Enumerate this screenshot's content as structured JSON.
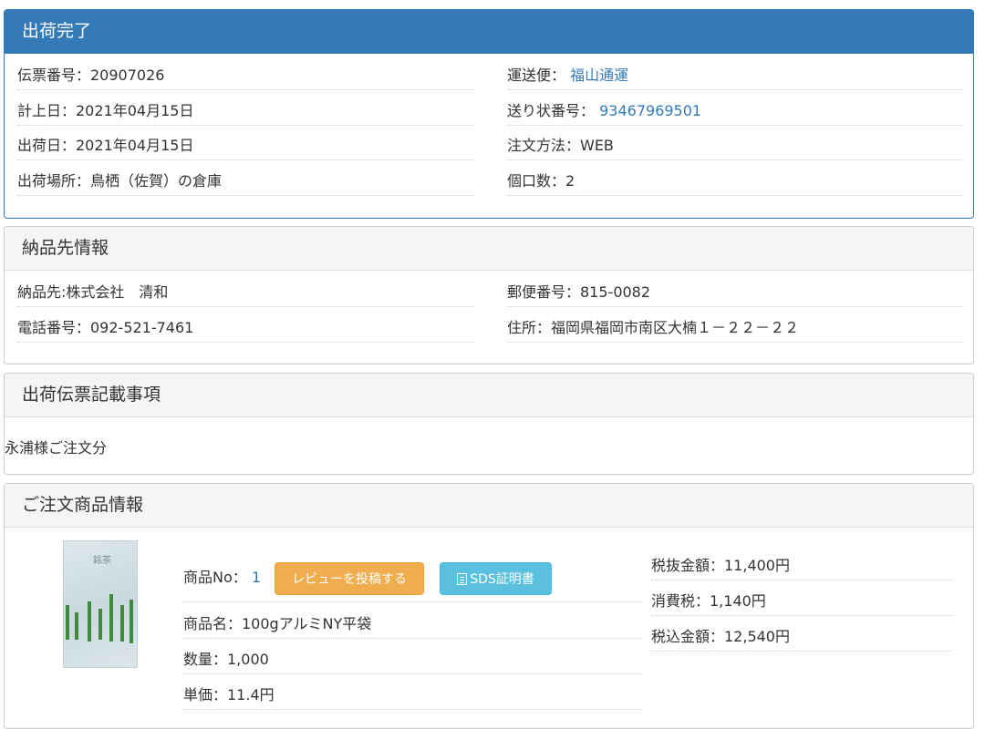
{
  "shipping": {
    "title": "出荷完了",
    "slip_no": "伝票番号：20907026",
    "carrier_label": "運送便：",
    "carrier_value": "福山通運",
    "posting_date": "計上日：2021年04月15日",
    "tracking_label": "送り状番号：",
    "tracking_value": "93467969501",
    "ship_date": "出荷日：2021年04月15日",
    "order_method": "注文方法：WEB",
    "ship_location": "出荷場所：鳥栖（佐賀）の倉庫",
    "packages": "個口数：2"
  },
  "delivery": {
    "title": "納品先情報",
    "recipient": "納品先:株式会社　清和",
    "postal": "郵便番号：815-0082",
    "phone": "電話番号：092-521-7461",
    "address": "住所：福岡県福岡市南区大楠１－２２－２２"
  },
  "slip_notes": {
    "title": "出荷伝票記載事項",
    "text": "永浦様ご注文分"
  },
  "order_items": {
    "title": "ご注文商品情報",
    "product_no_label": "商品No：",
    "product_no_value": "1",
    "review_button": "レビューを投稿する",
    "sds_button": "SDS証明書",
    "product_name": "商品名：100gアルミNY平袋",
    "quantity": "数量：1,000",
    "unit_price": "単価：11.4円",
    "subtotal": "税抜金額：11,400円",
    "tax": "消費税：1,140円",
    "total": "税込金額：12,540円",
    "image_label": "銘茶"
  },
  "colors": {
    "primary": "#337ab7",
    "warning": "#f0ad4e",
    "info": "#5bc0de"
  }
}
